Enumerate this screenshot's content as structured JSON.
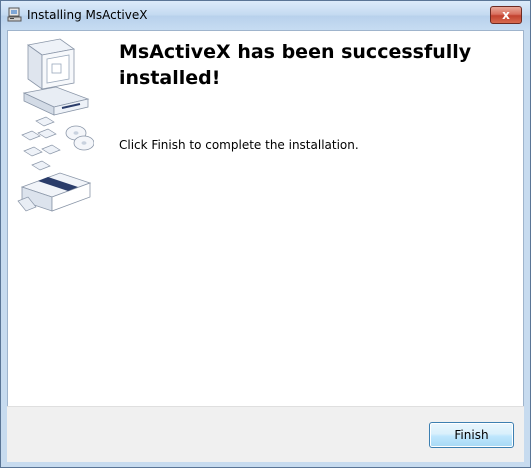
{
  "window": {
    "title": "Installing MsActiveX",
    "close_glyph": "x",
    "icon": "installer-icon"
  },
  "main": {
    "heading": "MsActiveX has been successfully installed!",
    "message": "Click Finish to complete the installation.",
    "artwork": "computer-disks-box-illustration"
  },
  "footer": {
    "finish_label": "Finish"
  },
  "colors": {
    "close_button": "#c7442f",
    "finish_border": "#3c7fb1",
    "frame": "#c7dbef"
  }
}
